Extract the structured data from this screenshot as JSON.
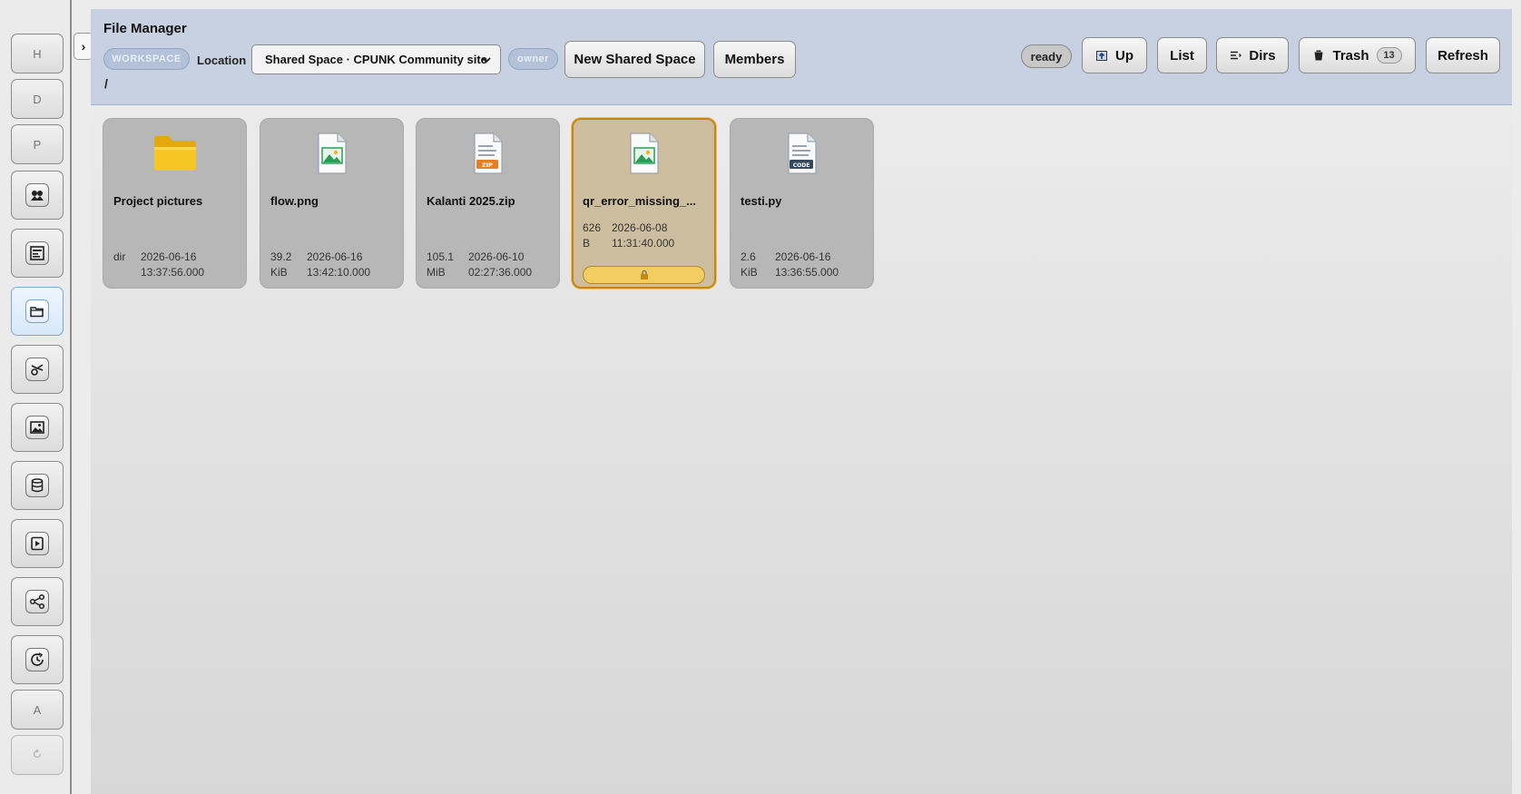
{
  "rail": {
    "letters": {
      "h": "H",
      "d": "D",
      "p": "P",
      "a": "A"
    },
    "toggle": "›"
  },
  "header": {
    "title": "File Manager",
    "workspace_pill": "WORKSPACE",
    "location_label": "Location",
    "location_value": "Shared Space · CPUNK Community site",
    "role_pill": "owner",
    "new_shared_space": "New Shared Space",
    "members": "Members",
    "status": "ready",
    "up": "Up",
    "list": "List",
    "dirs": "Dirs",
    "trash": "Trash",
    "trash_count": "13",
    "refresh": "Refresh",
    "path": "/"
  },
  "files": [
    {
      "name": "Project pictures",
      "type": "folder-icon",
      "size": "dir",
      "date": "2026-06-16",
      "time": "13:37:56.000",
      "selected": false
    },
    {
      "name": "flow.png",
      "type": "image-file-icon",
      "size": "39.2",
      "unit": "KiB",
      "date": "2026-06-16",
      "time": "13:42:10.000",
      "selected": false
    },
    {
      "name": "Kalanti 2025.zip",
      "type": "zip-file-icon",
      "size": "105.1",
      "unit": "MiB",
      "date": "2026-06-10",
      "time": "02:27:36.000",
      "selected": false
    },
    {
      "name": "qr_error_missing_...",
      "type": "image-file-icon",
      "size": "626",
      "unit": "B",
      "date": "2026-06-08",
      "time": "11:31:40.000",
      "selected": true,
      "locked": true
    },
    {
      "name": "testi.py",
      "type": "code-file-icon",
      "size": "2.6",
      "unit": "KiB",
      "date": "2026-06-16",
      "time": "13:36:55.000",
      "selected": false
    }
  ],
  "colors": {
    "header_bg": "#c8d1e1",
    "card_bg": "#b7b7b7",
    "selected_border": "#c8860f",
    "lock_bar": "#f2cd62",
    "folder": "#f3c21b"
  }
}
